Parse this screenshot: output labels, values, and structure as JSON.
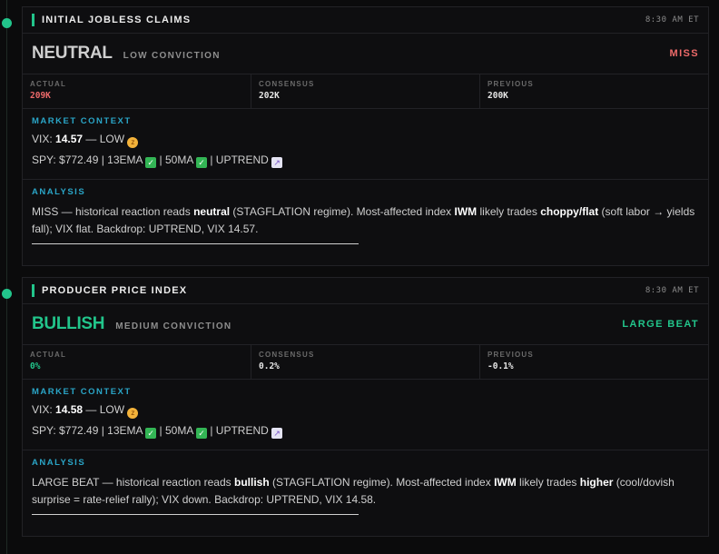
{
  "colors": {
    "accent": "#22c58b",
    "neutral_verdict": "#cfcfcf",
    "bullish_verdict": "#22c58b",
    "miss": "#ee6a6a",
    "beat": "#22c58b",
    "section_label": "#2aa5c7"
  },
  "events": [
    {
      "title": "INITIAL JOBLESS CLAIMS",
      "time": "8:30 AM ET",
      "verdict": "NEUTRAL",
      "conviction": "LOW CONVICTION",
      "outcome": "MISS",
      "stats": [
        {
          "label": "ACTUAL",
          "value": "209K"
        },
        {
          "label": "CONSENSUS",
          "value": "202K"
        },
        {
          "label": "PREVIOUS",
          "value": "200K"
        }
      ],
      "context_label": "MARKET CONTEXT",
      "vix": {
        "prefix": "VIX: ",
        "value": "14.57",
        "suffix": " — LOW "
      },
      "spy_line": {
        "part1": "SPY: $772.49 | 13EMA ",
        "part2": " | 50MA ",
        "part3": " | UPTREND "
      },
      "analysis_label": "ANALYSIS",
      "analysis": {
        "p1": "MISS — historical reaction reads ",
        "b1": "neutral",
        "p2": " (STAGFLATION regime). Most-affected index ",
        "b2": "IWM",
        "p3": " likely trades ",
        "b3": "choppy/flat",
        "p4": " (soft labor → yields fall); VIX flat. Backdrop: UPTREND, VIX 14.57."
      }
    },
    {
      "title": "PRODUCER PRICE INDEX",
      "time": "8:30 AM ET",
      "verdict": "BULLISH",
      "conviction": "MEDIUM CONVICTION",
      "outcome": "LARGE BEAT",
      "stats": [
        {
          "label": "ACTUAL",
          "value": "0%"
        },
        {
          "label": "CONSENSUS",
          "value": "0.2%"
        },
        {
          "label": "PREVIOUS",
          "value": "-0.1%"
        }
      ],
      "context_label": "MARKET CONTEXT",
      "vix": {
        "prefix": "VIX: ",
        "value": "14.58",
        "suffix": " — LOW "
      },
      "spy_line": {
        "part1": "SPY: $772.49 | 13EMA ",
        "part2": " | 50MA ",
        "part3": " | UPTREND "
      },
      "analysis_label": "ANALYSIS",
      "analysis": {
        "p1": "LARGE BEAT — historical reaction reads ",
        "b1": "bullish",
        "p2": " (STAGFLATION regime). Most-affected index ",
        "b2": "IWM",
        "p3": " likely trades ",
        "b3": "higher",
        "p4": " (cool/dovish surprise = rate-relief rally); VIX down. Backdrop: UPTREND, VIX 14.58."
      }
    }
  ]
}
